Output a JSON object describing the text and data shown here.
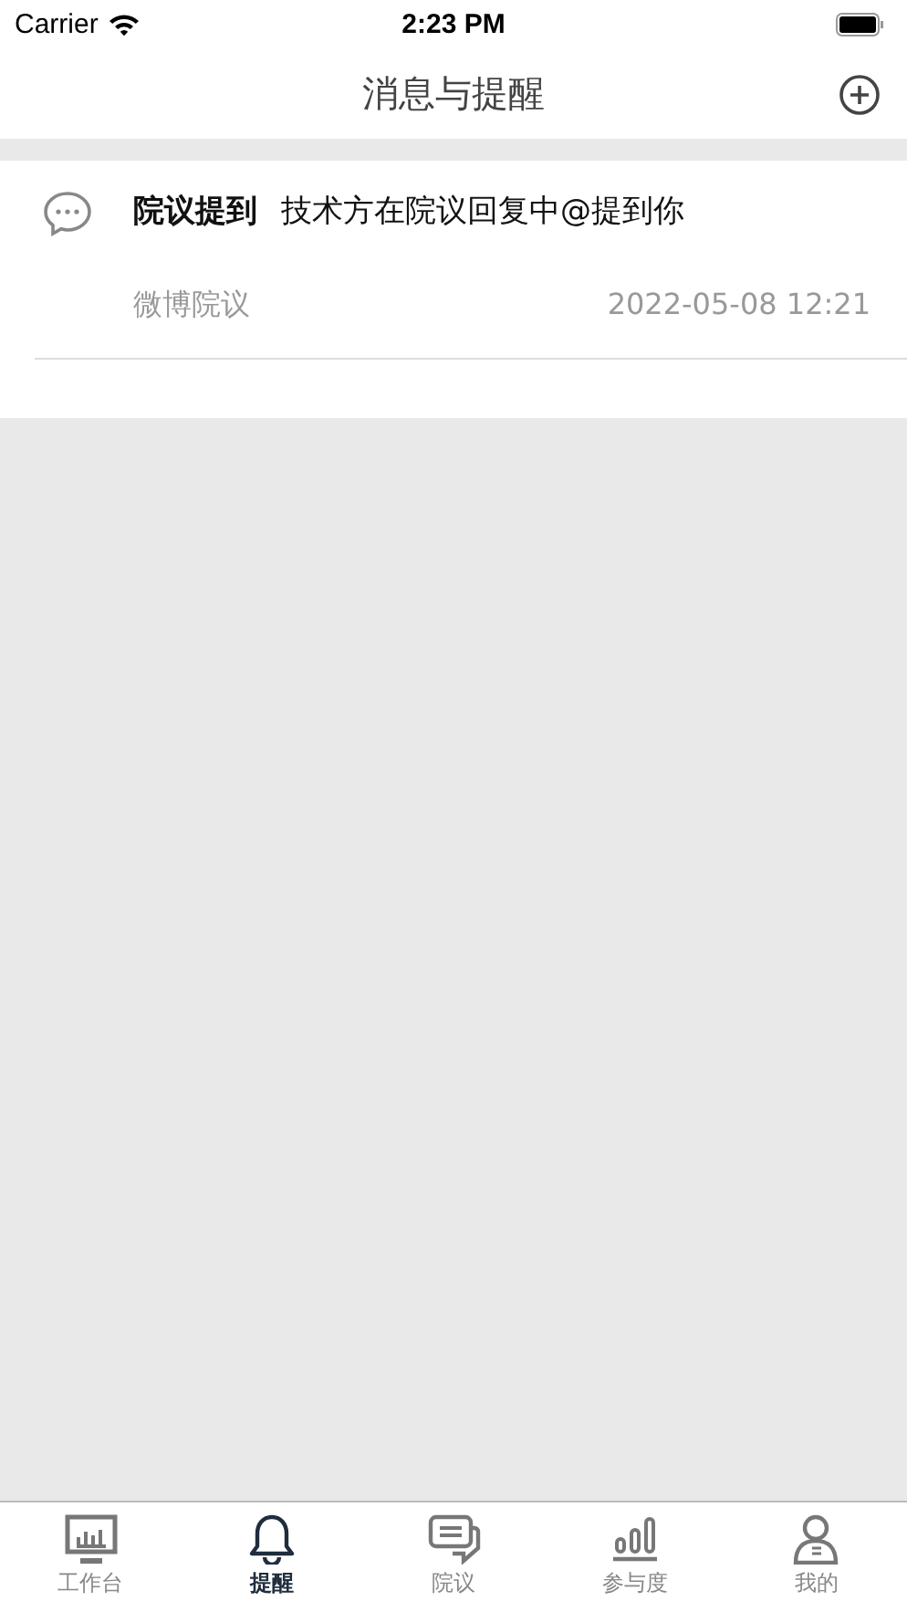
{
  "status_bar": {
    "carrier": "Carrier",
    "time": "2:23 PM"
  },
  "nav": {
    "title": "消息与提醒"
  },
  "messages": [
    {
      "kind": "comment",
      "title": "院议提到",
      "body": "技术方在院议回复中@提到你",
      "source": "微博院议",
      "time": "2022-05-08 12:21"
    }
  ],
  "tabs": [
    {
      "label": "工作台",
      "kind": "workbench",
      "selected": false
    },
    {
      "label": "提醒",
      "kind": "bell",
      "selected": true
    },
    {
      "label": "院议",
      "kind": "chat",
      "selected": false
    },
    {
      "label": "参与度",
      "kind": "bars",
      "selected": false
    },
    {
      "label": "我的",
      "kind": "person",
      "selected": false
    }
  ]
}
